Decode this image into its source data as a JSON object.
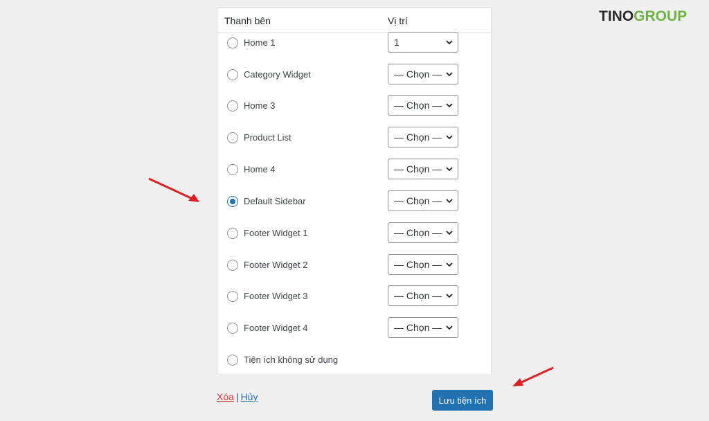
{
  "brand": {
    "part1": "TINO",
    "part2": "GROUP"
  },
  "table": {
    "col_sidebar": "Thanh bên",
    "col_position": "Vị trí"
  },
  "rows": [
    {
      "label": "Home 1",
      "checked": false,
      "select": "1"
    },
    {
      "label": "Category Widget",
      "checked": false,
      "select": "— Chọn —"
    },
    {
      "label": "Home 3",
      "checked": false,
      "select": "— Chọn —"
    },
    {
      "label": "Product List",
      "checked": false,
      "select": "— Chọn —"
    },
    {
      "label": "Home 4",
      "checked": false,
      "select": "— Chọn —"
    },
    {
      "label": "Default Sidebar",
      "checked": true,
      "select": "— Chọn —"
    },
    {
      "label": "Footer Widget 1",
      "checked": false,
      "select": "— Chọn —"
    },
    {
      "label": "Footer Widget 2",
      "checked": false,
      "select": "— Chọn —"
    },
    {
      "label": "Footer Widget 3",
      "checked": false,
      "select": "— Chọn —"
    },
    {
      "label": "Footer Widget 4",
      "checked": false,
      "select": "— Chọn —"
    },
    {
      "label": "Tiện ích không sử dụng",
      "checked": false,
      "select": null
    }
  ],
  "actions": {
    "delete_label": "Xóa",
    "separator": "|",
    "cancel_label": "Hủy",
    "save_label": "Lưu tiện ích"
  },
  "colors": {
    "accent": "#2271b1",
    "danger": "#d63638",
    "brand_green": "#6cb43f",
    "arrow": "#e02020"
  }
}
